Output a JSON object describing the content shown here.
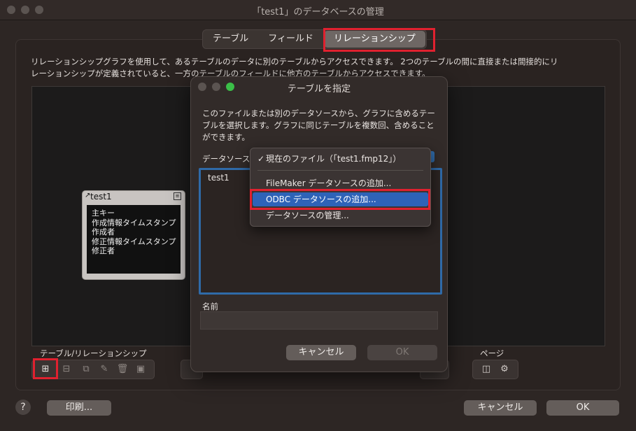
{
  "window": {
    "title": "「test1」のデータベースの管理"
  },
  "tabs": [
    "テーブル",
    "フィールド",
    "リレーションシップ"
  ],
  "description": "リレーションシップグラフを使用して、あるテーブルのデータに別のテーブルからアクセスできます。 2つのテーブルの間に直接または間接的にリレーションシップが定義されていると、一方のテーブルのフィールドに他方のテーブルからアクセスできます。",
  "table_box": {
    "name": "test1",
    "fields": [
      "主キー",
      "作成情報タイムスタンプ",
      "作成者",
      "修正情報タイムスタンプ",
      "修正者"
    ]
  },
  "bottom": {
    "tables_relationships_label": "テーブル/リレーションシップ",
    "page_label": "ページ",
    "print_button": "印刷...",
    "cancel_button": "キャンセル",
    "ok_button": "OK",
    "help": "?"
  },
  "dialog": {
    "title": "テーブルを指定",
    "text": "このファイルまたは別のデータソースから、グラフに含めるテーブルを選択します。グラフに同じテーブルを複数回、含めることができます。",
    "datasource_label": "データソース",
    "tables": [
      "test1"
    ],
    "name_label": "名前",
    "name_value": "",
    "cancel_button": "キャンセル",
    "ok_button": "OK"
  },
  "menu": {
    "items": [
      {
        "label": "現在のファイル（「test1.fmp12」）",
        "checked": true
      },
      {
        "label": "FileMaker データソースの追加..."
      },
      {
        "label": "ODBC データソースの追加...",
        "highlighted": true
      },
      {
        "label": "データソースの管理..."
      }
    ]
  },
  "colors": {
    "highlight": "#e0212f",
    "selection": "#2e63b8"
  }
}
